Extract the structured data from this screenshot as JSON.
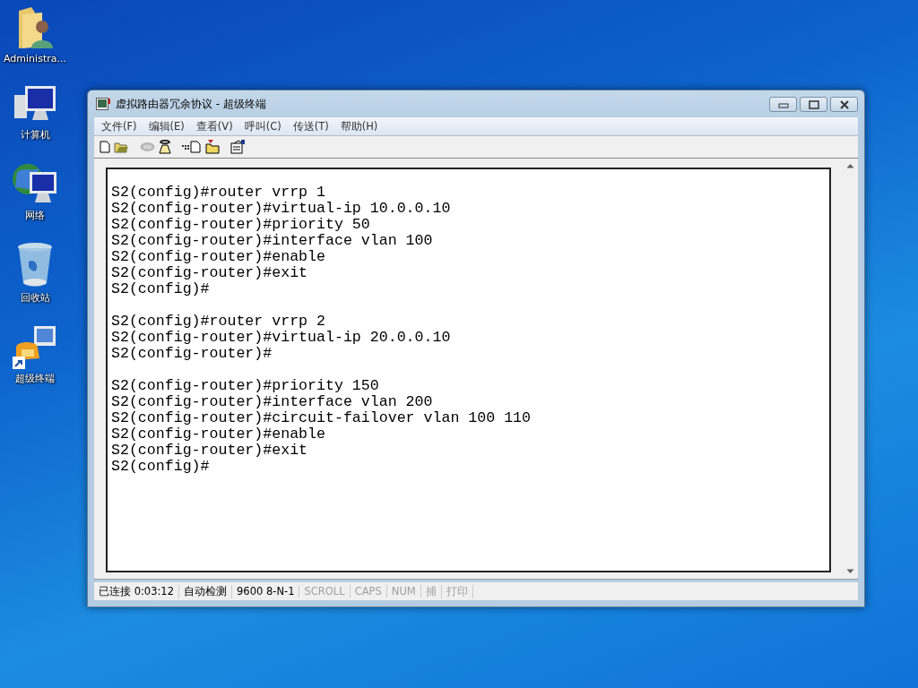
{
  "desktop_icons": [
    {
      "kind": "user-folder",
      "label": "Administra..."
    },
    {
      "kind": "computer",
      "label": "计算机"
    },
    {
      "kind": "network",
      "label": "网络"
    },
    {
      "kind": "recycle-bin",
      "label": "回收站"
    },
    {
      "kind": "terminal-shortcut",
      "label": "超级终端"
    }
  ],
  "window": {
    "title": "虚拟路由器冗余协议 - 超级终端"
  },
  "menu": [
    "文件(F)",
    "编辑(E)",
    "查看(V)",
    "呼叫(C)",
    "传送(T)",
    "帮助(H)"
  ],
  "toolbar": [
    {
      "kind": "new",
      "disabled": false
    },
    {
      "kind": "open",
      "disabled": false
    },
    {
      "kind": "hangup",
      "disabled": true
    },
    {
      "kind": "dial",
      "disabled": false
    },
    {
      "kind": "send",
      "disabled": false
    },
    {
      "kind": "receive",
      "disabled": false
    },
    {
      "kind": "properties",
      "disabled": false
    }
  ],
  "terminal": {
    "blocks": [
      [
        "S2(config)#router vrrp 1",
        "S2(config-router)#virtual-ip 10.0.0.10",
        "S2(config-router)#priority 50",
        "S2(config-router)#interface vlan 100",
        "S2(config-router)#enable",
        "S2(config-router)#exit",
        "S2(config)#"
      ],
      [
        "S2(config)#router vrrp 2",
        "S2(config-router)#virtual-ip 20.0.0.10",
        "S2(config-router)#"
      ],
      [
        "S2(config-router)#priority 150",
        "S2(config-router)#interface vlan 200",
        "S2(config-router)#circuit-failover vlan 100 110",
        "S2(config-router)#enable",
        "S2(config-router)#exit",
        "S2(config)#"
      ]
    ]
  },
  "status_bar": [
    {
      "text": "已连接 0:03:12",
      "disabled": false
    },
    {
      "text": "自动检测",
      "disabled": false
    },
    {
      "text": "9600 8-N-1",
      "disabled": false
    },
    {
      "text": "SCROLL",
      "disabled": true
    },
    {
      "text": "CAPS",
      "disabled": true
    },
    {
      "text": "NUM",
      "disabled": true
    },
    {
      "text": "捕",
      "disabled": true
    },
    {
      "text": "打印",
      "disabled": true
    }
  ]
}
